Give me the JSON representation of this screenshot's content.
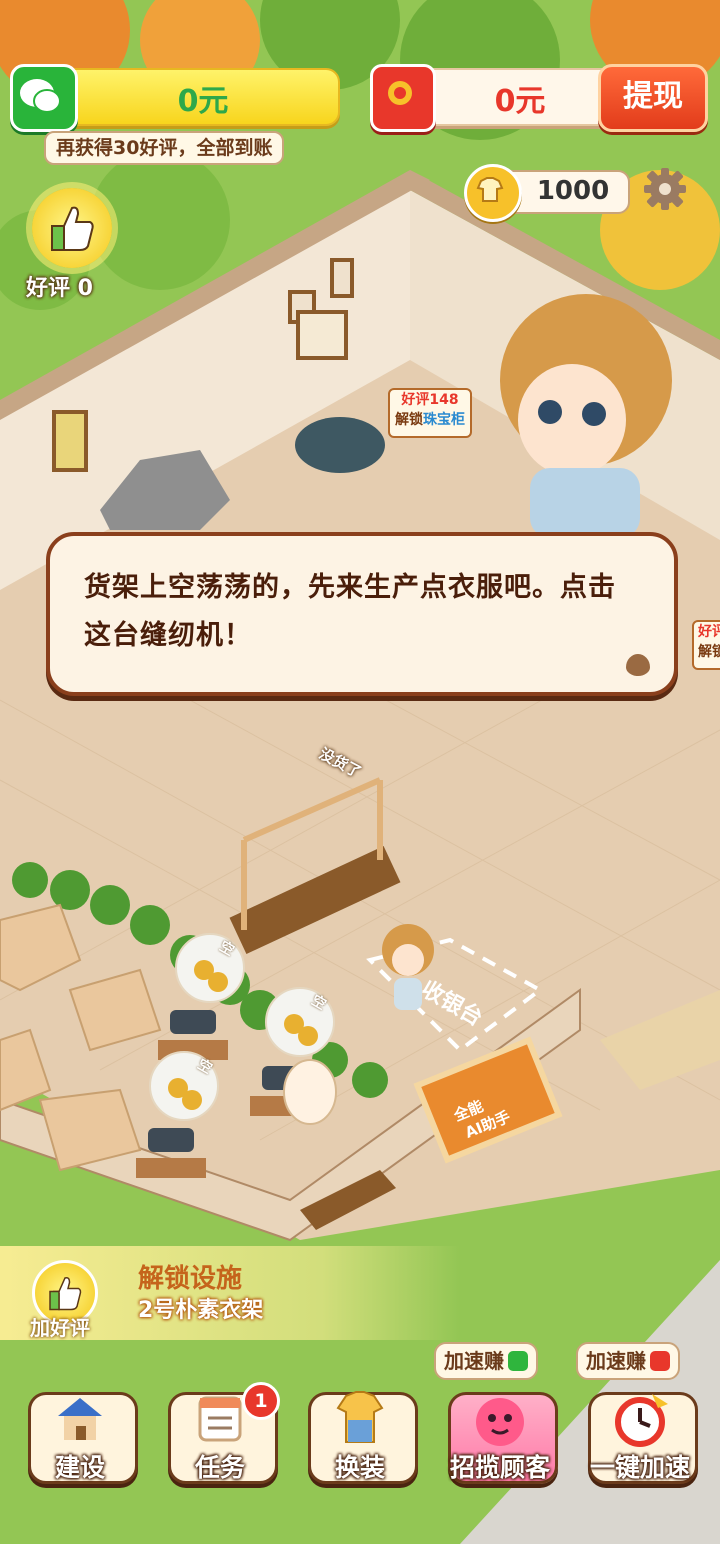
{
  "top": {
    "wallet_value": "0元",
    "wallet_hint": "再获得30好评，全部到账",
    "redpack_value": "0元",
    "withdraw_label": "提现",
    "coins_value": "1000"
  },
  "praise": {
    "label": "好评 0"
  },
  "scene": {
    "sign_jewelry_line1": "好评148",
    "sign_jewelry_line2_prefix": "解锁",
    "sign_jewelry_line2_item": "珠宝柜",
    "sign_edge_line1": "好评",
    "sign_edge_line2": "解锁",
    "rack_tag": "没货了",
    "empty_tag": "空",
    "cashier_label": "收银台",
    "ai_sign_line1": "全能",
    "ai_sign_line2": "AI助手"
  },
  "dialog": {
    "text": "货架上空荡荡的，先来生产点衣服吧。点击这台缝纫机！"
  },
  "unlock": {
    "icon_label": "加好评",
    "title": "解锁设施",
    "item": "2号朴素衣架"
  },
  "speed_chips": [
    {
      "label": "加速赚",
      "icon": "wechat-icon",
      "color": "#2fb53d"
    },
    {
      "label": "加速赚",
      "icon": "red-packet-icon",
      "color": "#e8372b"
    }
  ],
  "nav": {
    "build": "建设",
    "tasks": "任务",
    "tasks_badge": "1",
    "dress": "换装",
    "customers": "招揽顾客",
    "speedup": "一键加速"
  },
  "colors": {
    "brand_green": "#2fb53d",
    "brand_red": "#e8372b",
    "accent_yellow": "#f7d51d",
    "dialog_border": "#8a3f1c"
  }
}
